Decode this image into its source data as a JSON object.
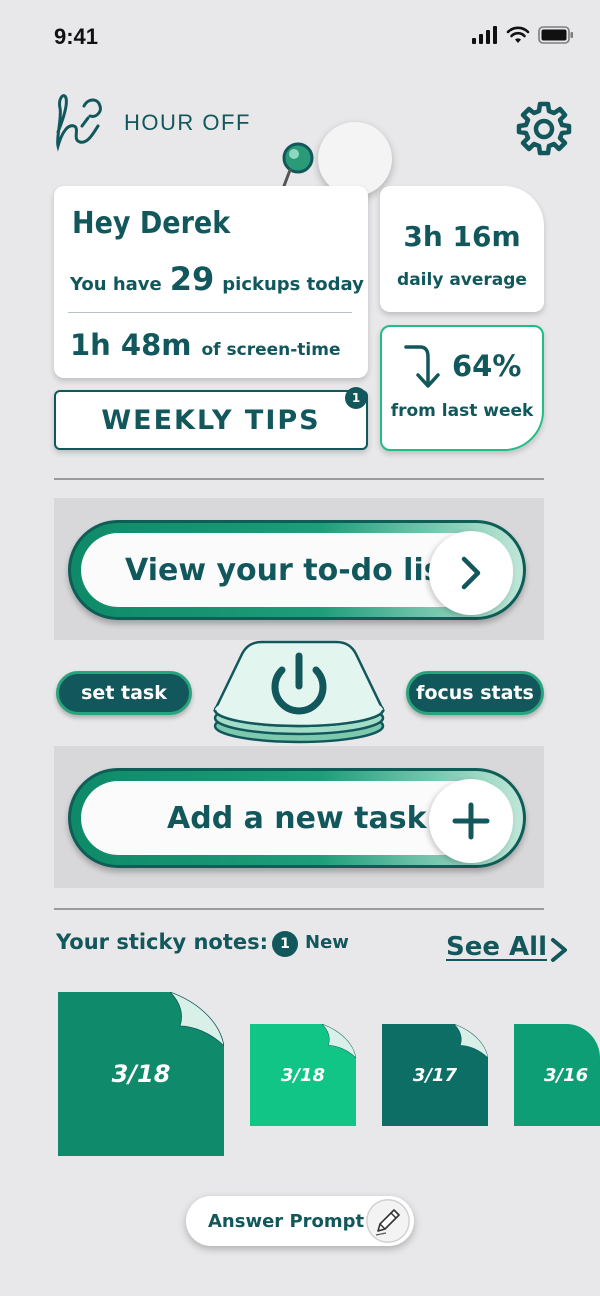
{
  "status_bar": {
    "time": "9:41"
  },
  "header": {
    "app_name": "HOUR OFF"
  },
  "greeting": {
    "title": "Hey Derek",
    "pickups_prefix": "You have",
    "pickups_count": "29",
    "pickups_suffix": "pickups today",
    "screen_time": "1h 48m",
    "screen_time_label": "of screen-time"
  },
  "daily_average": {
    "value": "3h 16m",
    "label": "daily average"
  },
  "weekly_change": {
    "value": "64%",
    "label": "from last week"
  },
  "weekly_tips": {
    "label": "WEEKLY TIPS",
    "badge": "1"
  },
  "todo_button": {
    "label": "View your to-do list"
  },
  "focus": {
    "set_task": "set task",
    "focus_stats": "focus stats"
  },
  "add_task_button": {
    "label": "Add a new task"
  },
  "sticky_notes": {
    "title": "Your sticky notes:",
    "new_count": "1",
    "new_label": "New",
    "see_all": "See All",
    "notes": [
      {
        "date": "3/18"
      },
      {
        "date": "3/18"
      },
      {
        "date": "3/17"
      },
      {
        "date": "3/16"
      }
    ]
  },
  "answer_prompt": {
    "label": "Answer Prompt"
  },
  "colors": {
    "primary": "#11575b",
    "accent": "#1fbf83",
    "background": "#e8e8ea"
  }
}
